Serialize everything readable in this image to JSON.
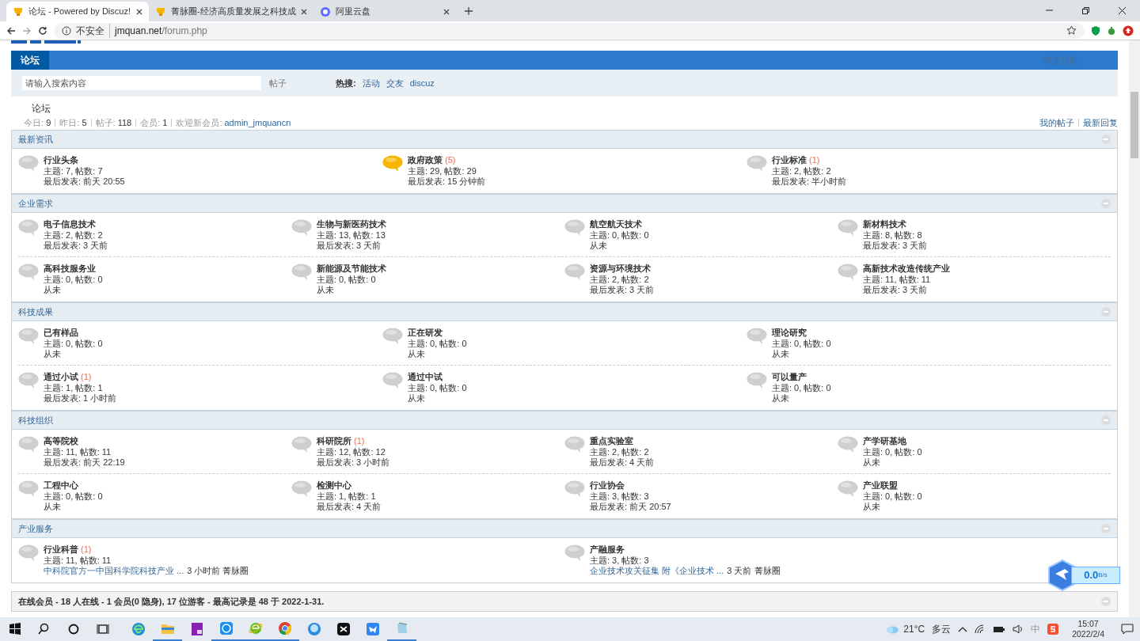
{
  "browser": {
    "tabs": [
      {
        "title": "论坛 - Powered by Discuz!",
        "selected": true
      },
      {
        "title": "菁脉圈-经济高质量发展之科技成",
        "selected": false
      },
      {
        "title": "阿里云盘",
        "selected": false
      }
    ],
    "security": "不安全",
    "url_host": "jmquan.net",
    "url_path": "/forum.php"
  },
  "nav": {
    "items": [
      {
        "label": "论坛",
        "selected": true
      }
    ],
    "quick_nav": "快捷导航"
  },
  "search": {
    "placeholder": "请输入搜索内容",
    "scope": "帖子",
    "hot_label": "热搜:",
    "hot": [
      "活动",
      "交友",
      "discuz"
    ]
  },
  "breadcrumb": "论坛",
  "stats": [
    "今日: **9**",
    "昨日: **5**",
    "帖子: **118**",
    "会员: **1**"
  ],
  "welcome_label": "欢迎新会员:",
  "new_member": "admin_jmquancn",
  "user_links": [
    "我的帖子",
    "最新回复"
  ],
  "sections": [
    {
      "title": "最新资讯",
      "expanded": true,
      "rows": [
        [
          {
            "name": "行业头条",
            "new": false,
            "stats": "主题: 7, 帖数: 7",
            "last": {
              "kind": "text",
              "text": "最后发表: 前天 20:55"
            }
          },
          {
            "name": "政府政策",
            "count": "(5)",
            "new": true,
            "stats": "主题: 29, 帖数: 29",
            "last": {
              "kind": "text",
              "text": "最后发表: 15 分钟前"
            }
          },
          {
            "name": "行业标准",
            "count": "(1)",
            "new": false,
            "stats": "主题: 2, 帖数: 2",
            "last": {
              "kind": "text",
              "text": "最后发表: 半小时前"
            }
          }
        ]
      ]
    },
    {
      "title": "企业需求",
      "expanded": true,
      "rows": [
        [
          {
            "name": "电子信息技术",
            "new": false,
            "stats": "主题: 2, 帖数: 2",
            "last": {
              "kind": "text",
              "text": "最后发表: 3 天前"
            }
          },
          {
            "name": "生物与新医药技术",
            "new": false,
            "stats": "主题: 13, 帖数: 13",
            "last": {
              "kind": "text",
              "text": "最后发表: 3 天前"
            }
          },
          {
            "name": "航空航天技术",
            "new": false,
            "stats": "主题: 0, 帖数: 0",
            "last": {
              "kind": "text",
              "text": "从未"
            }
          },
          {
            "name": "新材料技术",
            "new": false,
            "stats": "主题: 8, 帖数: 8",
            "last": {
              "kind": "text",
              "text": "最后发表: 3 天前"
            }
          }
        ],
        [
          {
            "name": "高科技服务业",
            "new": false,
            "stats": "主题: 0, 帖数: 0",
            "last": {
              "kind": "text",
              "text": "从未"
            }
          },
          {
            "name": "新能源及节能技术",
            "new": false,
            "stats": "主题: 0, 帖数: 0",
            "last": {
              "kind": "text",
              "text": "从未"
            }
          },
          {
            "name": "资源与环境技术",
            "new": false,
            "stats": "主题: 2, 帖数: 2",
            "last": {
              "kind": "text",
              "text": "最后发表: 3 天前"
            }
          },
          {
            "name": "高新技术改造传统产业",
            "new": false,
            "stats": "主题: 11, 帖数: 11",
            "last": {
              "kind": "text",
              "text": "最后发表: 3 天前"
            }
          }
        ]
      ]
    },
    {
      "title": "科技成果",
      "expanded": true,
      "rows": [
        [
          {
            "name": "已有样品",
            "new": false,
            "stats": "主题: 0, 帖数: 0",
            "last": {
              "kind": "text",
              "text": "从未"
            }
          },
          {
            "name": "正在研发",
            "new": false,
            "stats": "主题: 0, 帖数: 0",
            "last": {
              "kind": "text",
              "text": "从未"
            }
          },
          {
            "name": "理论研究",
            "new": false,
            "stats": "主题: 0, 帖数: 0",
            "last": {
              "kind": "text",
              "text": "从未"
            }
          }
        ],
        [
          {
            "name": "通过小试",
            "count": "(1)",
            "new": false,
            "stats": "主题: 1, 帖数: 1",
            "last": {
              "kind": "text",
              "text": "最后发表: 1 小时前"
            }
          },
          {
            "name": "通过中试",
            "new": false,
            "stats": "主题: 0, 帖数: 0",
            "last": {
              "kind": "text",
              "text": "从未"
            }
          },
          {
            "name": "可以量产",
            "new": false,
            "stats": "主题: 0, 帖数: 0",
            "last": {
              "kind": "text",
              "text": "从未"
            }
          }
        ]
      ]
    },
    {
      "title": "科技组织",
      "expanded": true,
      "rows": [
        [
          {
            "name": "高等院校",
            "new": false,
            "stats": "主题: 11, 帖数: 11",
            "last": {
              "kind": "text",
              "text": "最后发表: 前天 22:19"
            }
          },
          {
            "name": "科研院所",
            "count": "(1)",
            "new": false,
            "stats": "主题: 12, 帖数: 12",
            "last": {
              "kind": "text",
              "text": "最后发表: 3 小时前"
            }
          },
          {
            "name": "重点实验室",
            "new": false,
            "stats": "主题: 2, 帖数: 2",
            "last": {
              "kind": "text",
              "text": "最后发表: 4 天前"
            }
          },
          {
            "name": "产学研基地",
            "new": false,
            "stats": "主题: 0, 帖数: 0",
            "last": {
              "kind": "text",
              "text": "从未"
            }
          }
        ],
        [
          {
            "name": "工程中心",
            "new": false,
            "stats": "主题: 0, 帖数: 0",
            "last": {
              "kind": "text",
              "text": "从未"
            }
          },
          {
            "name": "检测中心",
            "new": false,
            "stats": "主题: 1, 帖数: 1",
            "last": {
              "kind": "text",
              "text": "最后发表: 4 天前"
            }
          },
          {
            "name": "行业协会",
            "new": false,
            "stats": "主题: 3, 帖数: 3",
            "last": {
              "kind": "text",
              "text": "最后发表: 前天 20:57"
            }
          },
          {
            "name": "产业联盟",
            "new": false,
            "stats": "主题: 0, 帖数: 0",
            "last": {
              "kind": "text",
              "text": "从未"
            }
          }
        ]
      ]
    },
    {
      "title": "产业服务",
      "expanded": true,
      "rows": [
        [
          {
            "name": "行业科普",
            "count": "(1)",
            "new": false,
            "stats": "主题: 11, 帖数: 11",
            "last": {
              "kind": "link",
              "link": "中科院官方一中国科学院科技产业 ...",
              "text": "3 小时前 菁脉圈"
            }
          },
          {
            "name": "产融服务",
            "new": false,
            "stats": "主题: 3, 帖数: 3",
            "last": {
              "kind": "link",
              "link": "企业技术攻关征集 附《企业技术 ...",
              "text": "3 天前 菁脉圈"
            }
          }
        ]
      ]
    }
  ],
  "online": {
    "text": "在线会员 - 18 人在线 - 1 会员(0 隐身), 17 位游客 - 最高记录是 48 于 2022-1-31.",
    "expanded": true
  },
  "speed_widget": {
    "speed": "0.0",
    "unit": "B/s"
  },
  "taskbar": {
    "apps": [
      {
        "kind": "start",
        "running": false
      },
      {
        "kind": "search",
        "running": false
      },
      {
        "kind": "cortana",
        "running": false
      },
      {
        "kind": "taskview",
        "running": false
      },
      {
        "kind": "edge",
        "running": false
      },
      {
        "kind": "folder",
        "running": true
      },
      {
        "kind": "rp",
        "running": false
      },
      {
        "kind": "k",
        "running": true
      },
      {
        "kind": "ie",
        "running": true
      },
      {
        "kind": "chrome",
        "running": true
      },
      {
        "kind": "bird",
        "running": false
      },
      {
        "kind": "capcut",
        "running": false
      },
      {
        "kind": "thunder",
        "running": false
      },
      {
        "kind": "notepad",
        "running": true
      }
    ],
    "temperature": "21°C",
    "weather": "多云",
    "ime": "中",
    "time": "15:07",
    "date": "2022/2/4"
  }
}
